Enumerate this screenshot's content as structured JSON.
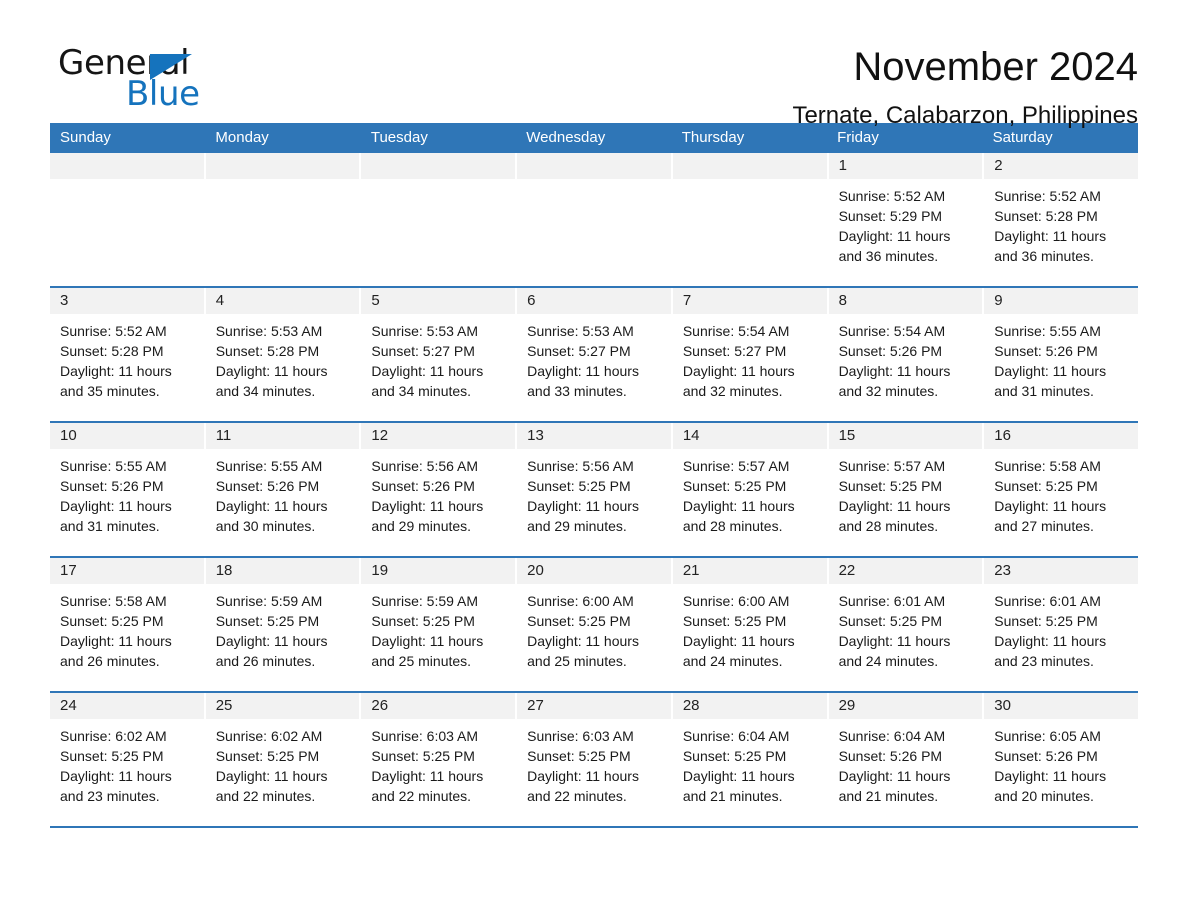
{
  "brand": {
    "name_part1": "General",
    "name_part2": "Blue",
    "triangle_icon": "triangle-icon",
    "blue": "#1573bd"
  },
  "header": {
    "title": "November 2024",
    "subtitle": "Ternate, Calabarzon, Philippines"
  },
  "colors": {
    "header_blue": "#2f76b7",
    "daynum_gray": "#f2f2f2",
    "text": "#1a1a1a"
  },
  "calendar": {
    "weekdays": [
      "Sunday",
      "Monday",
      "Tuesday",
      "Wednesday",
      "Thursday",
      "Friday",
      "Saturday"
    ],
    "weeks": [
      [
        {
          "day": "",
          "empty": true
        },
        {
          "day": "",
          "empty": true
        },
        {
          "day": "",
          "empty": true
        },
        {
          "day": "",
          "empty": true
        },
        {
          "day": "",
          "empty": true
        },
        {
          "day": "1",
          "sunrise": "Sunrise: 5:52 AM",
          "sunset": "Sunset: 5:29 PM",
          "daylight": "Daylight: 11 hours and 36 minutes."
        },
        {
          "day": "2",
          "sunrise": "Sunrise: 5:52 AM",
          "sunset": "Sunset: 5:28 PM",
          "daylight": "Daylight: 11 hours and 36 minutes."
        }
      ],
      [
        {
          "day": "3",
          "sunrise": "Sunrise: 5:52 AM",
          "sunset": "Sunset: 5:28 PM",
          "daylight": "Daylight: 11 hours and 35 minutes."
        },
        {
          "day": "4",
          "sunrise": "Sunrise: 5:53 AM",
          "sunset": "Sunset: 5:28 PM",
          "daylight": "Daylight: 11 hours and 34 minutes."
        },
        {
          "day": "5",
          "sunrise": "Sunrise: 5:53 AM",
          "sunset": "Sunset: 5:27 PM",
          "daylight": "Daylight: 11 hours and 34 minutes."
        },
        {
          "day": "6",
          "sunrise": "Sunrise: 5:53 AM",
          "sunset": "Sunset: 5:27 PM",
          "daylight": "Daylight: 11 hours and 33 minutes."
        },
        {
          "day": "7",
          "sunrise": "Sunrise: 5:54 AM",
          "sunset": "Sunset: 5:27 PM",
          "daylight": "Daylight: 11 hours and 32 minutes."
        },
        {
          "day": "8",
          "sunrise": "Sunrise: 5:54 AM",
          "sunset": "Sunset: 5:26 PM",
          "daylight": "Daylight: 11 hours and 32 minutes."
        },
        {
          "day": "9",
          "sunrise": "Sunrise: 5:55 AM",
          "sunset": "Sunset: 5:26 PM",
          "daylight": "Daylight: 11 hours and 31 minutes."
        }
      ],
      [
        {
          "day": "10",
          "sunrise": "Sunrise: 5:55 AM",
          "sunset": "Sunset: 5:26 PM",
          "daylight": "Daylight: 11 hours and 31 minutes."
        },
        {
          "day": "11",
          "sunrise": "Sunrise: 5:55 AM",
          "sunset": "Sunset: 5:26 PM",
          "daylight": "Daylight: 11 hours and 30 minutes."
        },
        {
          "day": "12",
          "sunrise": "Sunrise: 5:56 AM",
          "sunset": "Sunset: 5:26 PM",
          "daylight": "Daylight: 11 hours and 29 minutes."
        },
        {
          "day": "13",
          "sunrise": "Sunrise: 5:56 AM",
          "sunset": "Sunset: 5:25 PM",
          "daylight": "Daylight: 11 hours and 29 minutes."
        },
        {
          "day": "14",
          "sunrise": "Sunrise: 5:57 AM",
          "sunset": "Sunset: 5:25 PM",
          "daylight": "Daylight: 11 hours and 28 minutes."
        },
        {
          "day": "15",
          "sunrise": "Sunrise: 5:57 AM",
          "sunset": "Sunset: 5:25 PM",
          "daylight": "Daylight: 11 hours and 28 minutes."
        },
        {
          "day": "16",
          "sunrise": "Sunrise: 5:58 AM",
          "sunset": "Sunset: 5:25 PM",
          "daylight": "Daylight: 11 hours and 27 minutes."
        }
      ],
      [
        {
          "day": "17",
          "sunrise": "Sunrise: 5:58 AM",
          "sunset": "Sunset: 5:25 PM",
          "daylight": "Daylight: 11 hours and 26 minutes."
        },
        {
          "day": "18",
          "sunrise": "Sunrise: 5:59 AM",
          "sunset": "Sunset: 5:25 PM",
          "daylight": "Daylight: 11 hours and 26 minutes."
        },
        {
          "day": "19",
          "sunrise": "Sunrise: 5:59 AM",
          "sunset": "Sunset: 5:25 PM",
          "daylight": "Daylight: 11 hours and 25 minutes."
        },
        {
          "day": "20",
          "sunrise": "Sunrise: 6:00 AM",
          "sunset": "Sunset: 5:25 PM",
          "daylight": "Daylight: 11 hours and 25 minutes."
        },
        {
          "day": "21",
          "sunrise": "Sunrise: 6:00 AM",
          "sunset": "Sunset: 5:25 PM",
          "daylight": "Daylight: 11 hours and 24 minutes."
        },
        {
          "day": "22",
          "sunrise": "Sunrise: 6:01 AM",
          "sunset": "Sunset: 5:25 PM",
          "daylight": "Daylight: 11 hours and 24 minutes."
        },
        {
          "day": "23",
          "sunrise": "Sunrise: 6:01 AM",
          "sunset": "Sunset: 5:25 PM",
          "daylight": "Daylight: 11 hours and 23 minutes."
        }
      ],
      [
        {
          "day": "24",
          "sunrise": "Sunrise: 6:02 AM",
          "sunset": "Sunset: 5:25 PM",
          "daylight": "Daylight: 11 hours and 23 minutes."
        },
        {
          "day": "25",
          "sunrise": "Sunrise: 6:02 AM",
          "sunset": "Sunset: 5:25 PM",
          "daylight": "Daylight: 11 hours and 22 minutes."
        },
        {
          "day": "26",
          "sunrise": "Sunrise: 6:03 AM",
          "sunset": "Sunset: 5:25 PM",
          "daylight": "Daylight: 11 hours and 22 minutes."
        },
        {
          "day": "27",
          "sunrise": "Sunrise: 6:03 AM",
          "sunset": "Sunset: 5:25 PM",
          "daylight": "Daylight: 11 hours and 22 minutes."
        },
        {
          "day": "28",
          "sunrise": "Sunrise: 6:04 AM",
          "sunset": "Sunset: 5:25 PM",
          "daylight": "Daylight: 11 hours and 21 minutes."
        },
        {
          "day": "29",
          "sunrise": "Sunrise: 6:04 AM",
          "sunset": "Sunset: 5:26 PM",
          "daylight": "Daylight: 11 hours and 21 minutes."
        },
        {
          "day": "30",
          "sunrise": "Sunrise: 6:05 AM",
          "sunset": "Sunset: 5:26 PM",
          "daylight": "Daylight: 11 hours and 20 minutes."
        }
      ]
    ]
  }
}
